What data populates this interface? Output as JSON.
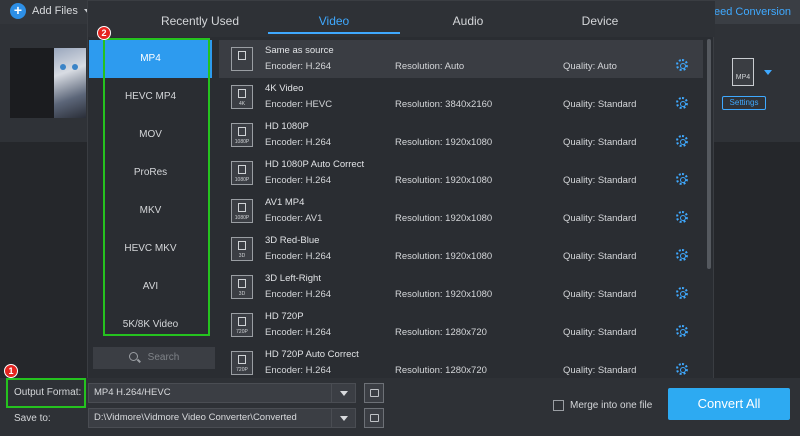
{
  "topbar": {
    "add_files": "Add Files",
    "speed_conversion": "eed Conversion"
  },
  "file_panel": {
    "format_icon_label": "MP4",
    "settings_label": "Settings"
  },
  "popup": {
    "tabs": [
      {
        "label": "Recently Used",
        "active": false
      },
      {
        "label": "Video",
        "active": true
      },
      {
        "label": "Audio",
        "active": false
      },
      {
        "label": "Device",
        "active": false
      }
    ],
    "formats": [
      "MP4",
      "HEVC MP4",
      "MOV",
      "ProRes",
      "MKV",
      "HEVC MKV",
      "AVI",
      "5K/8K Video"
    ],
    "active_format": "MP4",
    "search_placeholder": "Search",
    "badge_formats": "2",
    "presets": [
      {
        "name": "Same as source",
        "encoder": "Encoder: H.264",
        "resolution": "Resolution: Auto",
        "quality": "Quality: Auto",
        "icon": "",
        "active": true
      },
      {
        "name": "4K Video",
        "encoder": "Encoder: HEVC",
        "resolution": "Resolution: 3840x2160",
        "quality": "Quality: Standard",
        "icon": "4K"
      },
      {
        "name": "HD 1080P",
        "encoder": "Encoder: H.264",
        "resolution": "Resolution: 1920x1080",
        "quality": "Quality: Standard",
        "icon": "1080P"
      },
      {
        "name": "HD 1080P Auto Correct",
        "encoder": "Encoder: H.264",
        "resolution": "Resolution: 1920x1080",
        "quality": "Quality: Standard",
        "icon": "1080P"
      },
      {
        "name": "AV1 MP4",
        "encoder": "Encoder: AV1",
        "resolution": "Resolution: 1920x1080",
        "quality": "Quality: Standard",
        "icon": "1080P"
      },
      {
        "name": "3D Red-Blue",
        "encoder": "Encoder: H.264",
        "resolution": "Resolution: 1920x1080",
        "quality": "Quality: Standard",
        "icon": "3D"
      },
      {
        "name": "3D Left-Right",
        "encoder": "Encoder: H.264",
        "resolution": "Resolution: 1920x1080",
        "quality": "Quality: Standard",
        "icon": "3D"
      },
      {
        "name": "HD 720P",
        "encoder": "Encoder: H.264",
        "resolution": "Resolution: 1280x720",
        "quality": "Quality: Standard",
        "icon": "720P"
      },
      {
        "name": "HD 720P Auto Correct",
        "encoder": "Encoder: H.264",
        "resolution": "Resolution: 1280x720",
        "quality": "Quality: Standard",
        "icon": "720P"
      }
    ]
  },
  "bottom": {
    "badge_output": "1",
    "output_format_label": "Output Format:",
    "output_format_value": "MP4 H.264/HEVC",
    "save_to_label": "Save to:",
    "save_to_value": "D:\\Vidmore\\Vidmore Video Converter\\Converted",
    "merge_label": "Merge into one file",
    "convert_all": "Convert All"
  },
  "colors": {
    "accent": "#2d9bef",
    "highlight_box": "#25c21f",
    "badge": "#e52420"
  }
}
